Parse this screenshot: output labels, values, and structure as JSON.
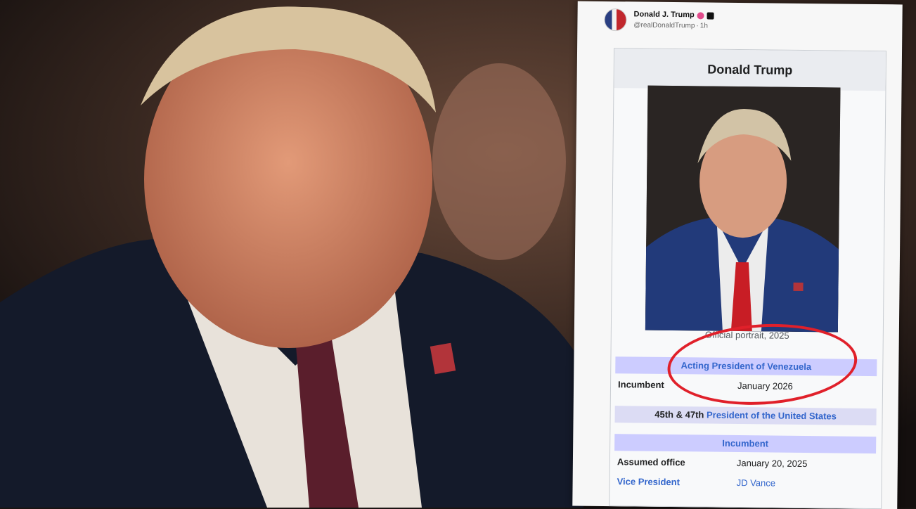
{
  "post": {
    "author": "Donald J. Trump",
    "handle": "@realDonaldTrump",
    "time": "1h"
  },
  "infobox": {
    "title": "Donald Trump",
    "caption": "Official portrait, 2025",
    "office1": "Acting President of Venezuela",
    "incumbent_label": "Incumbent",
    "office1_date": "January 2026",
    "office2_prefix": "45th & 47th",
    "office2": "President of the United States",
    "office2_status": "Incumbent",
    "assumed_label": "Assumed office",
    "assumed_value": "January 20, 2025",
    "vp_label": "Vice President",
    "vp_value": "JD Vance"
  }
}
